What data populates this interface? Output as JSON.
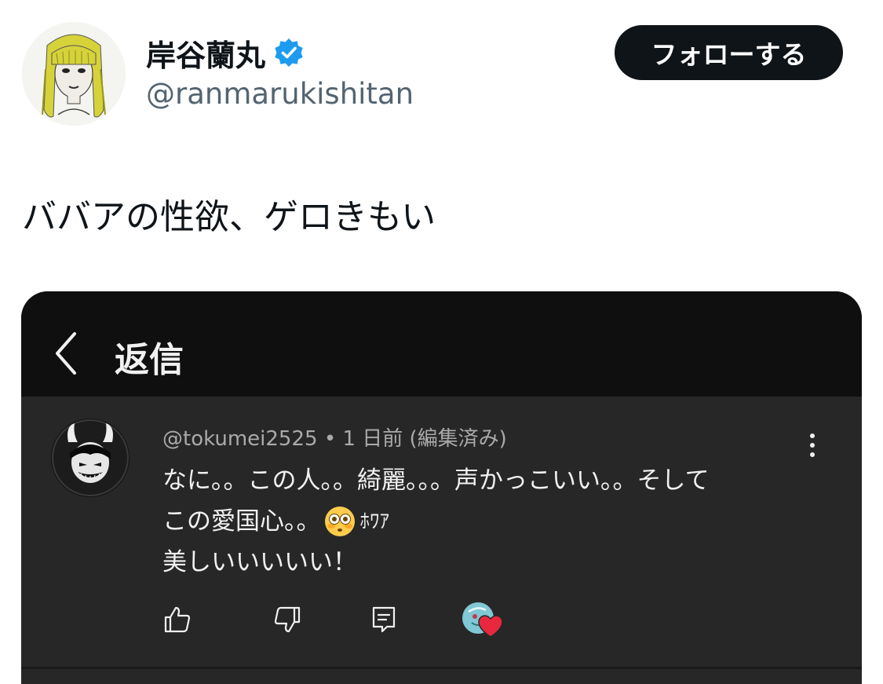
{
  "profile": {
    "display_name": "岸谷蘭丸",
    "handle": "@ranmarukishitan",
    "verified_icon": "verified-badge-icon",
    "follow_label": "フォローする"
  },
  "tweet": {
    "text": "ババアの性欲、ゲロきもい"
  },
  "embedded_screenshot": {
    "header_title": "返信",
    "comment": {
      "author": "@tokumei2525",
      "separator": "•",
      "time": "1 日前",
      "edited": "(編集済み)",
      "line1": "なに。。この人。。綺麗。。。声かっこいい。。そして",
      "line2_text": "この愛国心。。",
      "line2_suffix": "ﾎﾜｱ",
      "line3": "美しいいいいい！"
    },
    "icons": {
      "back": "chevron-left-icon",
      "more": "kebab-menu-icon",
      "like": "thumbs-up-icon",
      "dislike": "thumbs-down-icon",
      "reply": "reply-comment-icon",
      "creator_heart": "creator-heart-icon",
      "emoji": "flushed-face-emoji"
    },
    "colors": {
      "header_bg": "#0f0f0f",
      "comment_bg": "#272727",
      "heart": "#e8283c"
    }
  }
}
